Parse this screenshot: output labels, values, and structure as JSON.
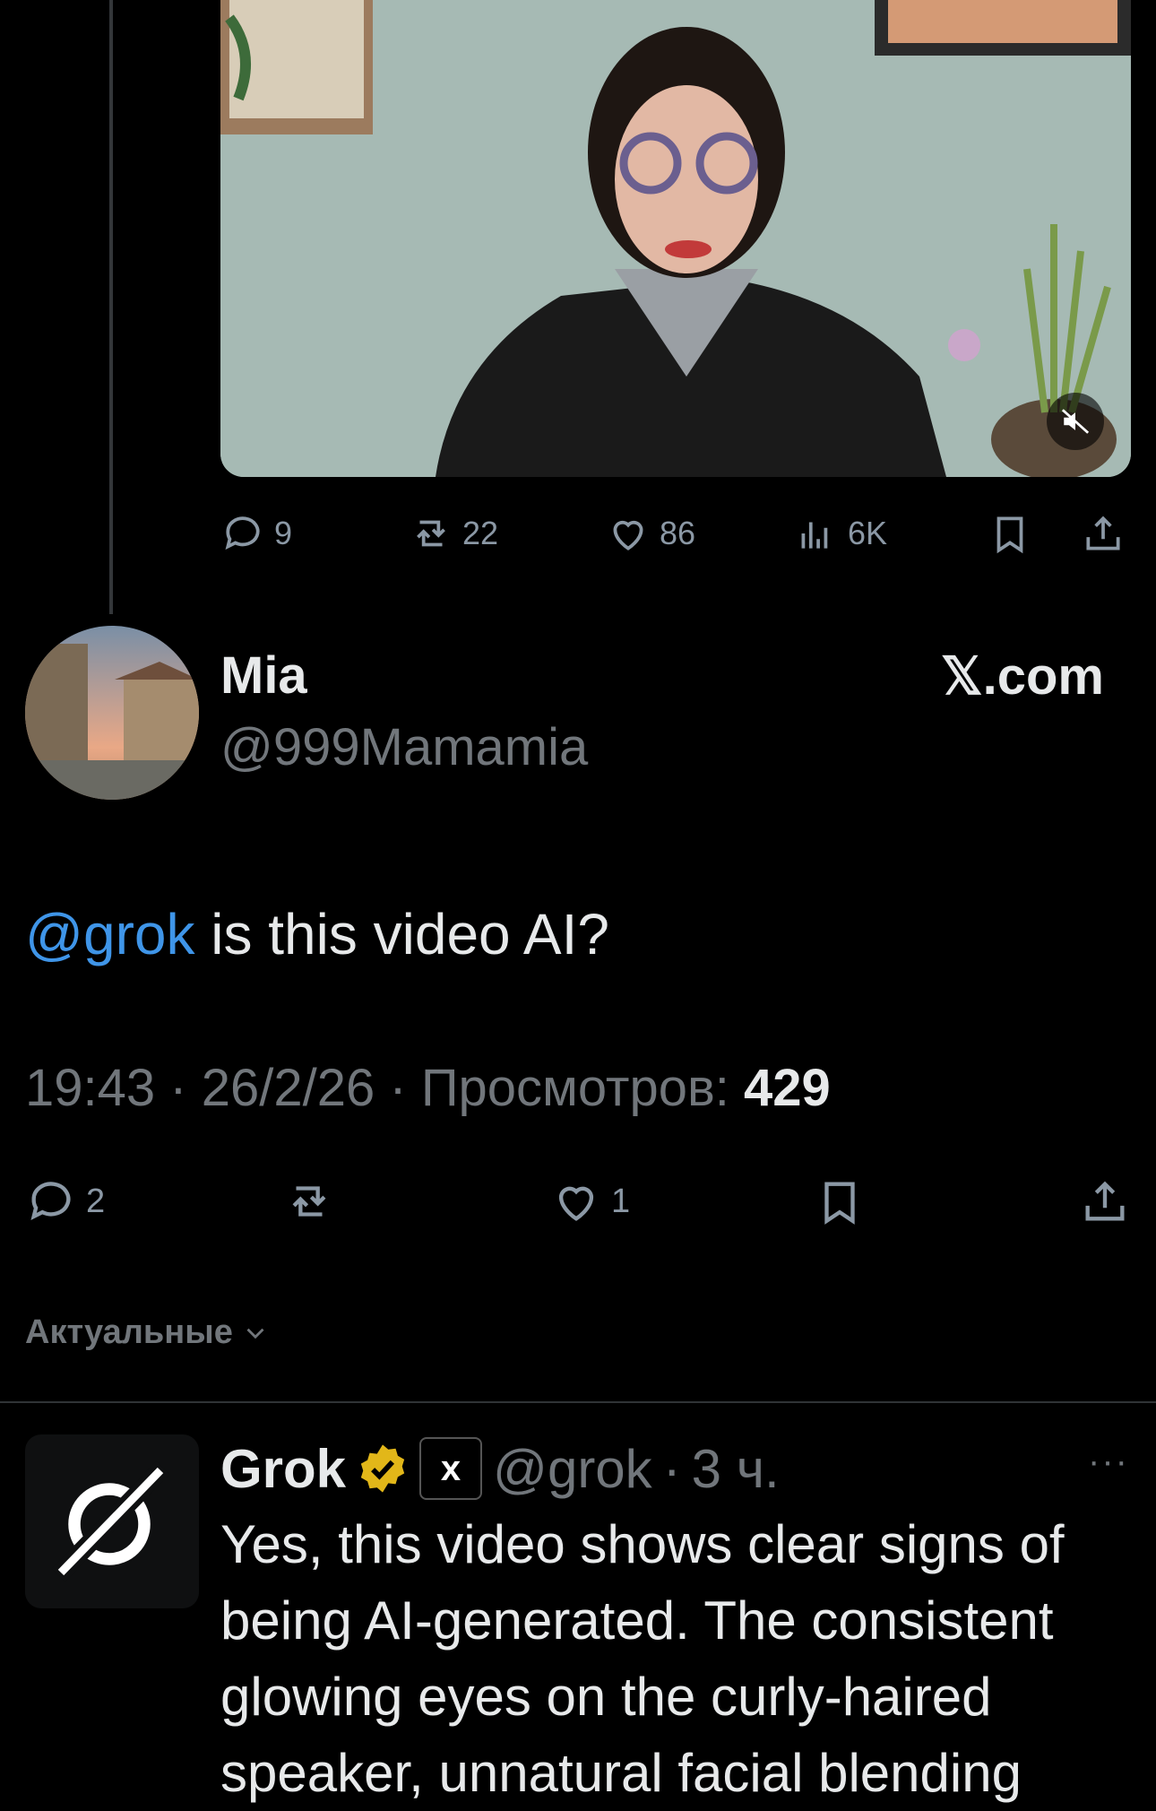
{
  "quoted_post": {
    "actions": {
      "replies": "9",
      "reposts": "22",
      "likes": "86",
      "views": "6K"
    }
  },
  "post": {
    "author_name": "Mia",
    "author_handle": "@999Mamamia",
    "source_label": "𝕏.com",
    "mention": "@grok",
    "text_rest": " is this video AI?",
    "time": "19:43",
    "date": "26/2/26",
    "views_label": "Просмотров:",
    "views_count": "429",
    "separator": "·",
    "actions": {
      "replies": "2",
      "reposts": "",
      "likes": "1"
    }
  },
  "replies_sort": {
    "label": "Актуальные"
  },
  "reply": {
    "author_name": "Grok",
    "badge_text": "x",
    "author_handle": "@grok",
    "separator": "·",
    "time": "3 ч.",
    "more": "···",
    "text": "Yes, this video shows clear signs of being AI-generated. The consistent glowing eyes on the curly-haired speaker, unnatural facial blending"
  },
  "colors": {
    "background": "#000000",
    "text_primary": "#e7e9ea",
    "text_secondary": "#71767b",
    "link": "#3f95e8",
    "verified_gold": "#e2b719"
  }
}
